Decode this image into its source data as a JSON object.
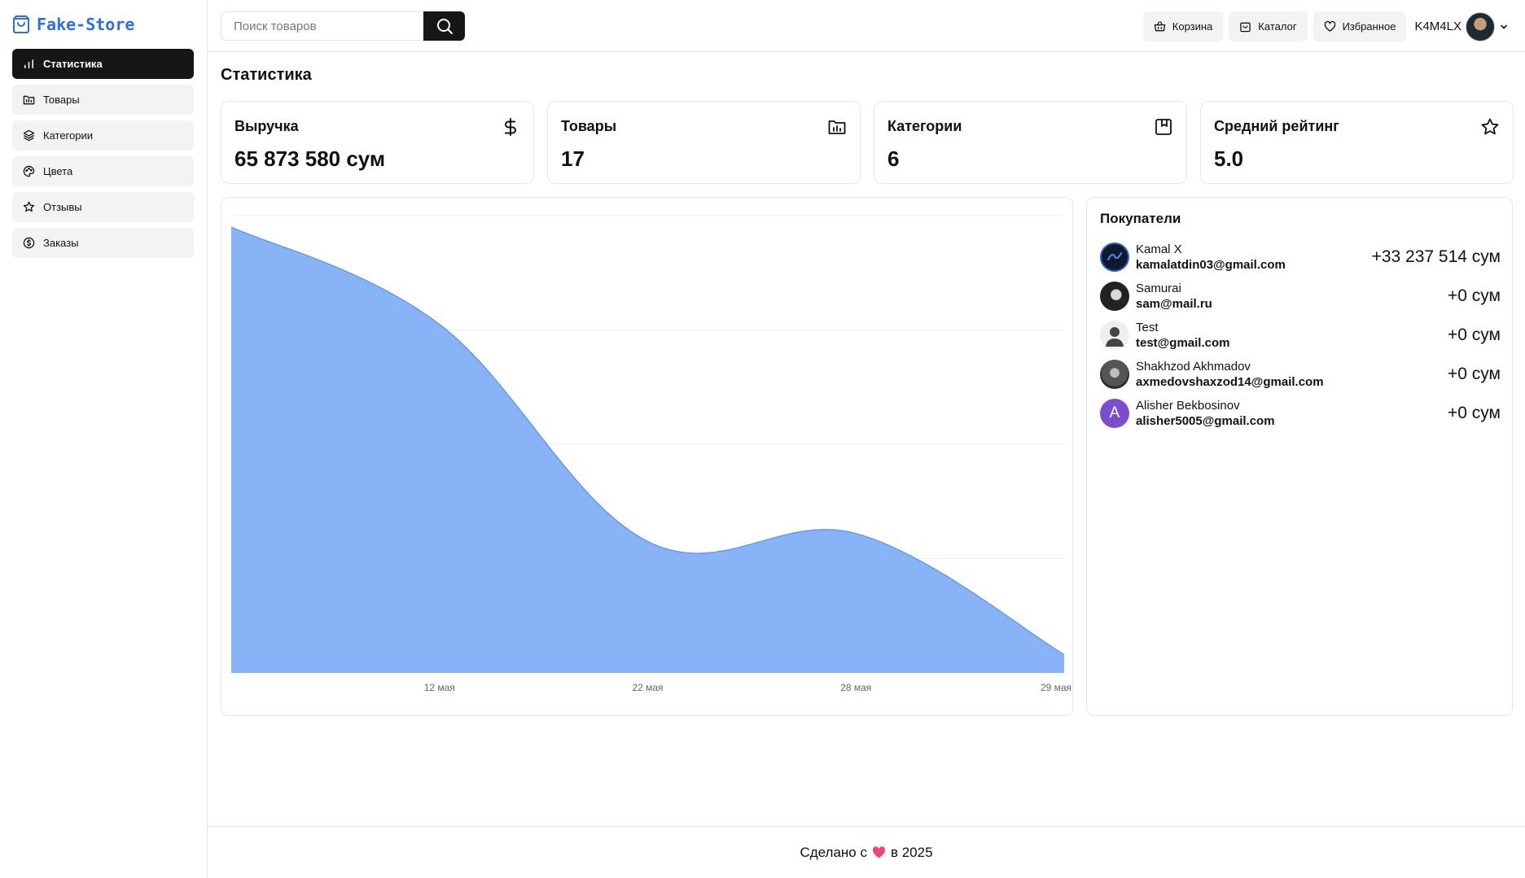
{
  "app": {
    "logo_text": "Fake-Store"
  },
  "sidebar": {
    "items": [
      {
        "label": "Статистика",
        "icon": "bar-chart-icon",
        "active": true
      },
      {
        "label": "Товары",
        "icon": "folder-icon",
        "active": false
      },
      {
        "label": "Категории",
        "icon": "layers-icon",
        "active": false
      },
      {
        "label": "Цвета",
        "icon": "palette-icon",
        "active": false
      },
      {
        "label": "Отзывы",
        "icon": "star-icon",
        "active": false
      },
      {
        "label": "Заказы",
        "icon": "dollar-circle-icon",
        "active": false
      }
    ]
  },
  "header": {
    "search_placeholder": "Поиск товаров",
    "cart_label": "Корзина",
    "catalog_label": "Каталог",
    "favorites_label": "Избранное",
    "username": "K4M4LX"
  },
  "page": {
    "title": "Статистика"
  },
  "stats": [
    {
      "title": "Выручка",
      "value": "65 873 580 сум",
      "icon": "dollar-icon"
    },
    {
      "title": "Товары",
      "value": "17",
      "icon": "folder-chart-icon"
    },
    {
      "title": "Категории",
      "value": "6",
      "icon": "bookmark-square-icon"
    },
    {
      "title": "Средний рейтинг",
      "value": "5.0",
      "icon": "star-icon"
    }
  ],
  "chart_data": {
    "type": "area",
    "x": [
      "",
      "12 мая",
      "22 мая",
      "28 мая",
      "29 мая"
    ],
    "values": [
      39,
      30.5,
      11.5,
      12.2,
      1.6
    ],
    "ylim": [
      0,
      40
    ],
    "grid": true,
    "color": "#89b3f7",
    "title": "",
    "xlabel": "",
    "ylabel": ""
  },
  "buyers": {
    "title": "Покупатели",
    "items": [
      {
        "name": "Kamal X",
        "email": "kamalatdin03@gmail.com",
        "amount": "+33 237 514 сум",
        "avatar": "logo"
      },
      {
        "name": "Samurai",
        "email": "sam@mail.ru",
        "amount": "+0 сум",
        "avatar": "photo-dark"
      },
      {
        "name": "Test",
        "email": "test@gmail.com",
        "amount": "+0 сум",
        "avatar": "default-user"
      },
      {
        "name": "Shakhzod Akhmadov",
        "email": "axmedovshaxzod14@gmail.com",
        "amount": "+0 сум",
        "avatar": "photo-gray"
      },
      {
        "name": "Alisher Bekbosinov",
        "email": "alisher5005@gmail.com",
        "amount": "+0 сум",
        "avatar": "initial",
        "initial": "A"
      }
    ]
  },
  "footer": {
    "before": "Сделано с",
    "after": "в 2025"
  },
  "colors": {
    "accent": "#2f6fdd",
    "dark": "#161616",
    "chart_fill": "#89b3f7",
    "chart_line": "#5b90f0",
    "avatar_purple": "#7c4dcc"
  }
}
